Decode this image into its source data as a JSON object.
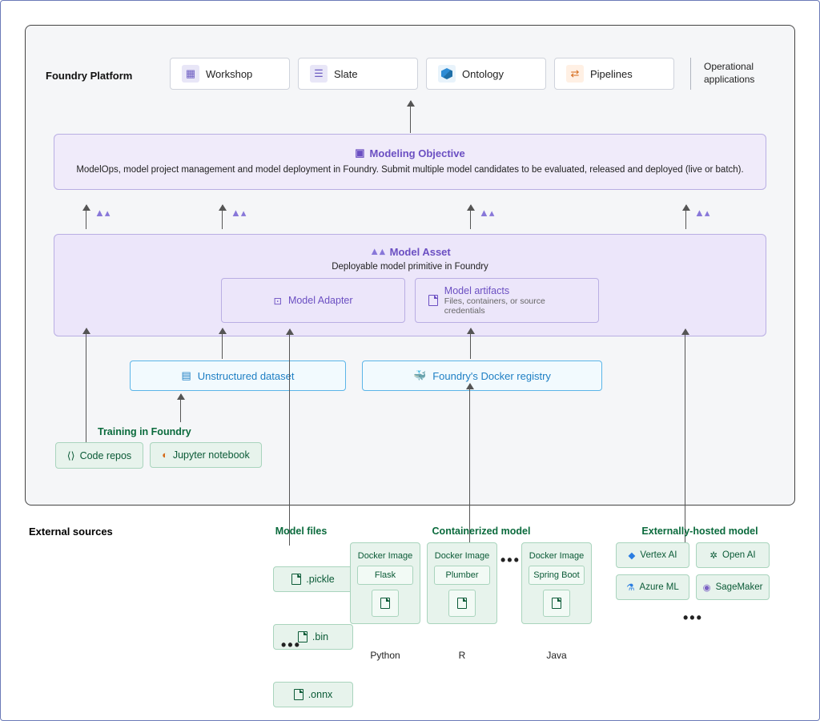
{
  "foundry": {
    "title": "Foundry Platform"
  },
  "apps": {
    "workshop": "Workshop",
    "slate": "Slate",
    "ontology": "Ontology",
    "pipelines": "Pipelines",
    "ops": "Operational\napplications"
  },
  "objective": {
    "title": "Modeling Objective",
    "desc": "ModelOps, model project management and model deployment in Foundry. Submit multiple model candidates to be evaluated, released and deployed (live or batch)."
  },
  "asset": {
    "title": "Model Asset",
    "subtitle": "Deployable model primitive in Foundry",
    "adapter": "Model Adapter",
    "artifacts": "Model artifacts",
    "artifacts_sub": "Files, containers, or source credentials"
  },
  "blue": {
    "unstructured": "Unstructured dataset",
    "docker": "Foundry's Docker registry"
  },
  "training": {
    "label": "Training in Foundry",
    "code": "Code repos",
    "jupyter": "Jupyter notebook"
  },
  "external": {
    "label": "External sources",
    "model_files": "Model files",
    "containerized": "Containerized model",
    "hosted": "Externally-hosted model",
    "files": [
      ".pickle",
      ".bin",
      ".onnx"
    ],
    "docker_img": "Docker Image",
    "frameworks": [
      "Flask",
      "Plumber",
      "Spring Boot"
    ],
    "langs": [
      "Python",
      "R",
      "Java"
    ],
    "hosted_list": [
      "Vertex AI",
      "Open AI",
      "Azure ML",
      "SageMaker"
    ]
  }
}
